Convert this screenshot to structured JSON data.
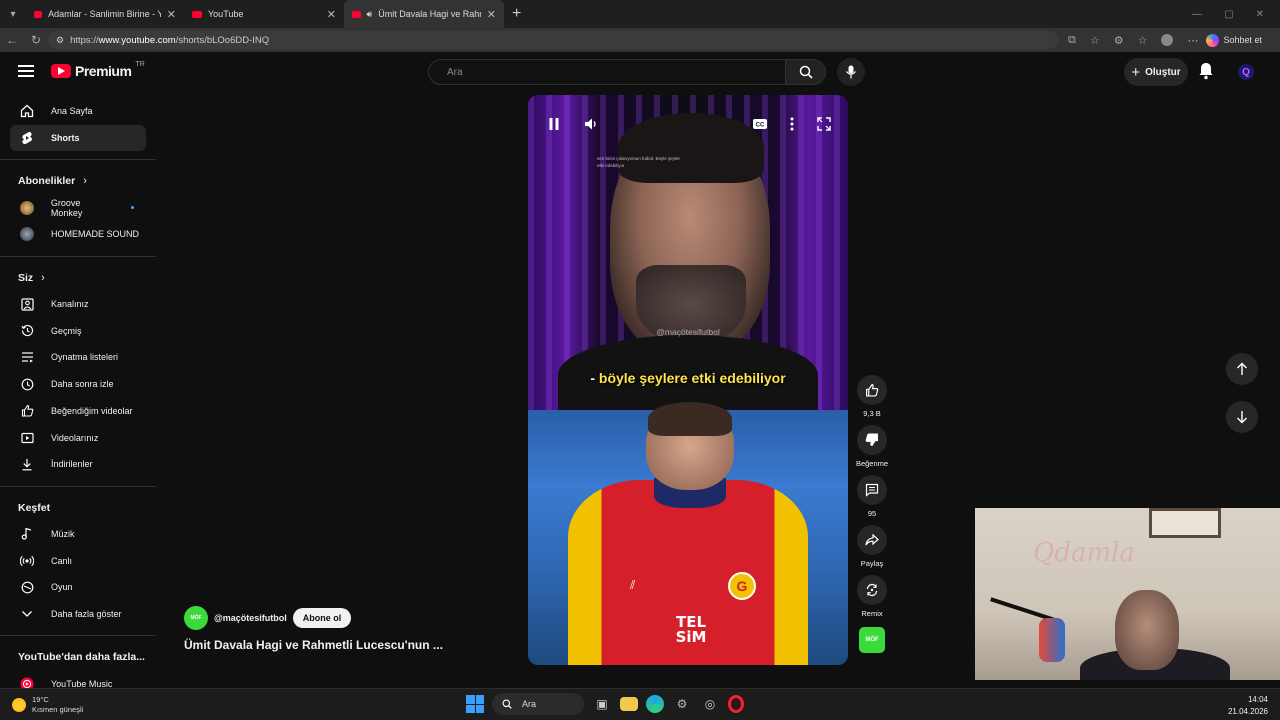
{
  "browser": {
    "tabs": [
      {
        "label": "Adamlar - Sanlimin Birine - YouTub",
        "active": false
      },
      {
        "label": "YouTube",
        "active": false
      },
      {
        "label": "Ümit Davala Hagi ve Rahmetli",
        "active": true
      }
    ],
    "url_prefix": "https://",
    "url_host": "www.youtube.com",
    "url_path": "/shorts/bLOo6DD-INQ",
    "sohbet_label": "Sohbet et"
  },
  "header": {
    "logo_text": "Premium",
    "logo_country": "TR",
    "search_placeholder": "Ara",
    "create_label": "Oluştur",
    "avatar_letter": "Q"
  },
  "sidebar": {
    "main": [
      {
        "label": "Ana Sayfa",
        "icon": "home-icon"
      },
      {
        "label": "Shorts",
        "icon": "shorts-icon"
      }
    ],
    "subs_title": "Abonelikler",
    "subs": [
      {
        "label": "Groove Monkey"
      },
      {
        "label": "HOMEMADE SOUND"
      }
    ],
    "you_title": "Siz",
    "you": [
      {
        "label": "Kanalınız",
        "icon": "channel-icon"
      },
      {
        "label": "Geçmiş",
        "icon": "history-icon"
      },
      {
        "label": "Oynatma listeleri",
        "icon": "playlist-icon"
      },
      {
        "label": "Daha sonra izle",
        "icon": "clock-icon"
      },
      {
        "label": "Beğendiğim videolar",
        "icon": "like-icon"
      },
      {
        "label": "Videolarınız",
        "icon": "video-icon"
      },
      {
        "label": "İndirilenler",
        "icon": "download-icon"
      }
    ],
    "explore_title": "Keşfet",
    "explore": [
      {
        "label": "Müzik",
        "icon": "music-icon"
      },
      {
        "label": "Canlı",
        "icon": "live-icon"
      },
      {
        "label": "Oyun",
        "icon": "gaming-icon"
      },
      {
        "label": "Daha fazla göster",
        "icon": "chevron-down-icon"
      }
    ],
    "more_title": "YouTube'dan daha fazla...",
    "more": [
      {
        "label": "YouTube Music",
        "icon": "youtube-music-icon"
      }
    ]
  },
  "video": {
    "watermark": "@maçötesifutbol",
    "tiny_caption": "sen birini çıkarıyorsun futbol. Böyle şeyler etki edebiliyor",
    "subtitle_prefix": "- ",
    "subtitle_highlight": "böyle şeylere etki edebiliyor",
    "sponsor_line1": "TEL",
    "sponsor_line2": "SiM",
    "badge_letter": "G"
  },
  "actions": {
    "like_count": "9,3 B",
    "dislike_label": "Beğenme",
    "comment_count": "95",
    "share_label": "Paylaş",
    "remix_label": "Remix",
    "remix_thumb_text": "MÖF"
  },
  "meta": {
    "channel_handle": "@maçötesifutbol",
    "channel_avatar_text": "MÖF",
    "subscribe_label": "Abone ol",
    "title": "Ümit Davala Hagi ve Rahmetli Lucescu'nun ..."
  },
  "webcam": {
    "wall_text": "Qdamla"
  },
  "taskbar": {
    "temperature": "19°C",
    "weather_desc": "Kısmen güneşli",
    "search_label": "Ara",
    "time": "14:04",
    "date": "21.04.2026"
  },
  "colors": {
    "brand_red": "#ff0033",
    "accent_blue": "#3ea6ff",
    "subtitle_yellow": "#ffe44d"
  }
}
